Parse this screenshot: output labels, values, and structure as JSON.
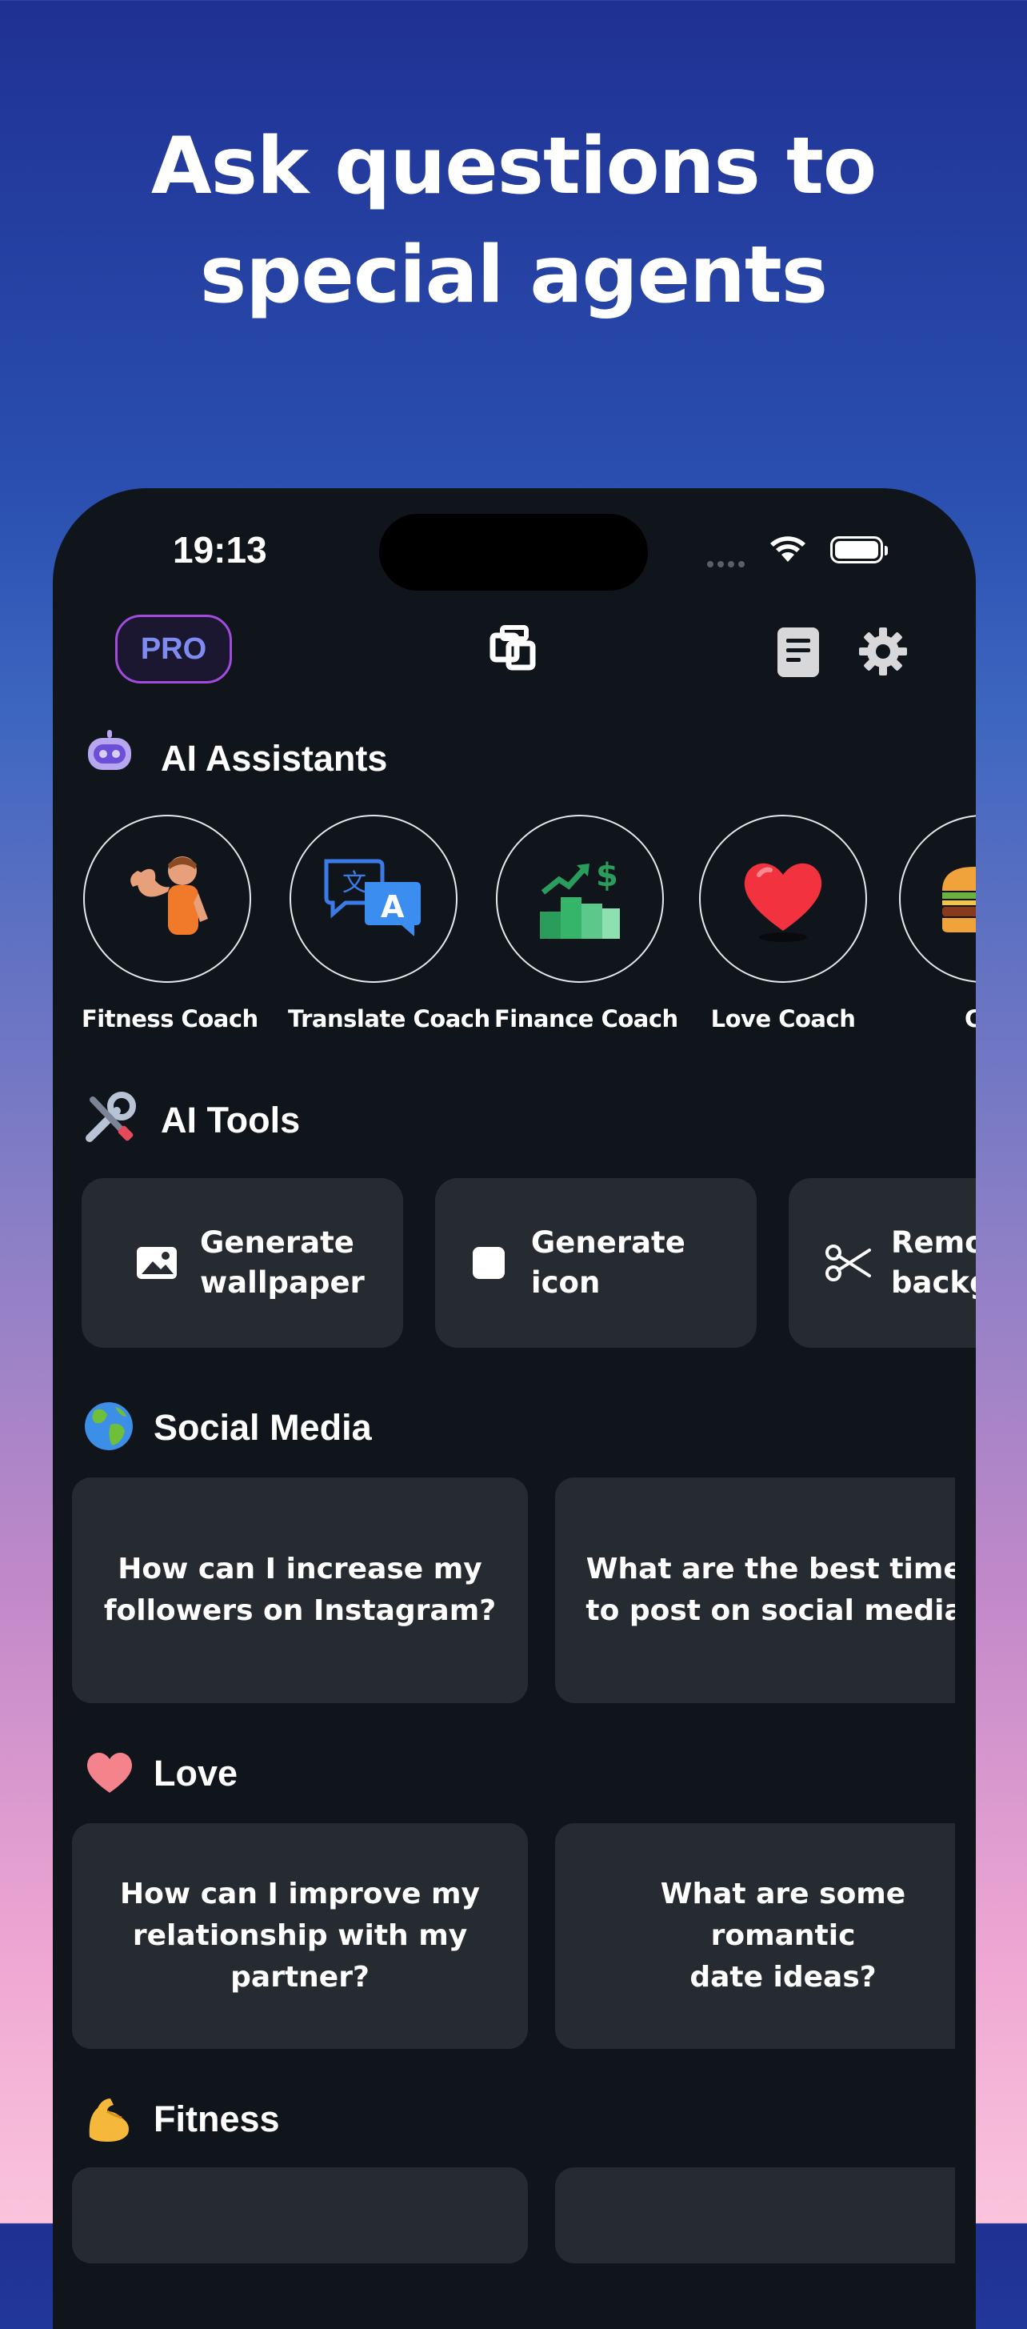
{
  "headline": {
    "line1": "Ask questions to",
    "line2": "special agents"
  },
  "status_bar": {
    "time": "19:13"
  },
  "header": {
    "pro_label": "PRO",
    "logo_icon": "app-logo-icon",
    "history_icon": "document-icon",
    "settings_icon": "gear-icon"
  },
  "sections": {
    "assistants": {
      "title": "AI Assistants",
      "icon": "robot-icon"
    },
    "tools": {
      "title": "AI Tools",
      "icon": "tools-icon"
    },
    "social": {
      "title": "Social Media",
      "icon": "globe-icon"
    },
    "love": {
      "title": "Love",
      "icon": "heart-icon"
    },
    "fitness": {
      "title": "Fitness",
      "icon": "flexed-biceps-icon"
    }
  },
  "assistants": [
    {
      "label": "Fitness Coach",
      "icon": "bodybuilder-icon"
    },
    {
      "label": "Translate Coach",
      "icon": "translate-icon"
    },
    {
      "label": "Finance Coach",
      "icon": "finance-chart-icon"
    },
    {
      "label": "Love Coach",
      "icon": "heart-icon"
    },
    {
      "label": "Cook",
      "icon": "burger-icon"
    }
  ],
  "tools": [
    {
      "label": "Generate\nwallpaper",
      "icon": "image-icon"
    },
    {
      "label": "Generate icon",
      "icon": "square-icon"
    },
    {
      "label": "Remo\nbackg",
      "icon": "scissors-icon"
    }
  ],
  "social_questions": [
    "How can I increase my\nfollowers on Instagram?",
    "What are the best times\nto post on social media?"
  ],
  "love_questions": [
    "How can I improve my\nrelationship with my\npartner?",
    "What are some romantic\ndate ideas?"
  ],
  "colors": {
    "card": "#262a31",
    "phone_bg": "#10141b",
    "pro_border": "#a24cdc",
    "pro_text": "#7e8cf2"
  }
}
